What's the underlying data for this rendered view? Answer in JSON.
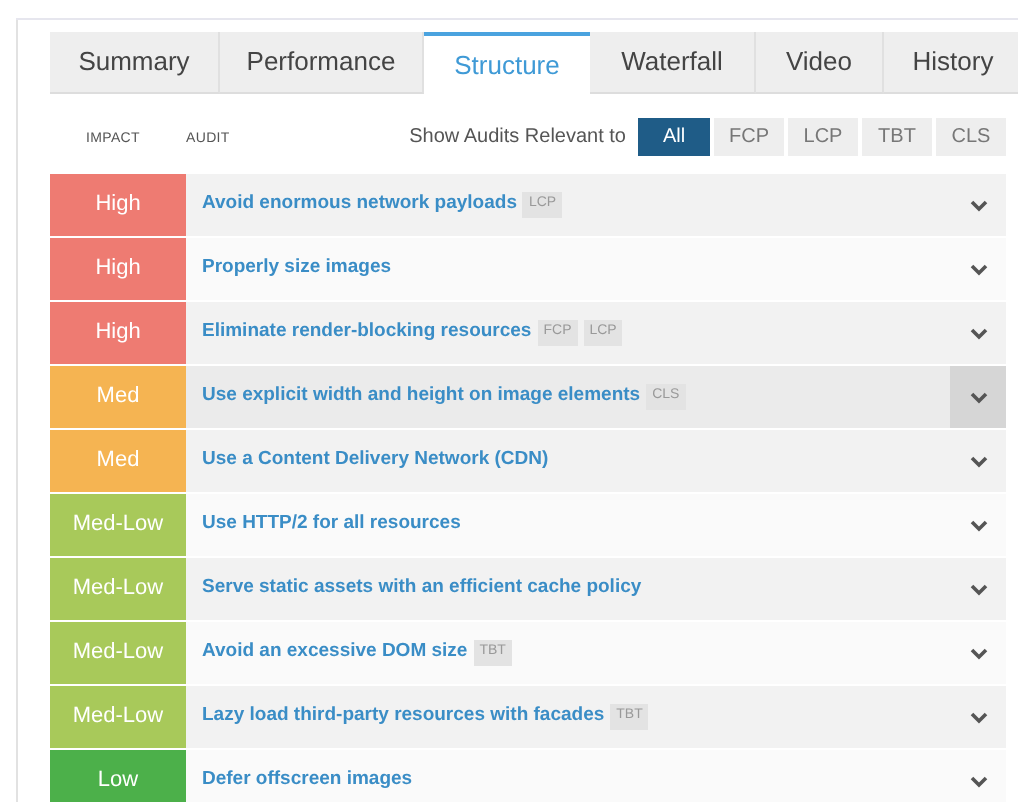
{
  "tabs": [
    {
      "label": "Summary",
      "selected": false
    },
    {
      "label": "Performance",
      "selected": false
    },
    {
      "label": "Structure",
      "selected": true
    },
    {
      "label": "Waterfall",
      "selected": false
    },
    {
      "label": "Video",
      "selected": false
    },
    {
      "label": "History",
      "selected": false
    }
  ],
  "filter": {
    "label": "Show Audits Relevant to",
    "options": [
      {
        "label": "All",
        "selected": true
      },
      {
        "label": "FCP",
        "selected": false
      },
      {
        "label": "LCP",
        "selected": false
      },
      {
        "label": "TBT",
        "selected": false
      },
      {
        "label": "CLS",
        "selected": false
      }
    ]
  },
  "columns": [
    "IMPACT",
    "AUDIT"
  ],
  "audits": [
    {
      "impact": "High",
      "color": "#ee7b72",
      "title": "Avoid enormous network payloads",
      "tags": [
        "LCP"
      ],
      "hovered": false
    },
    {
      "impact": "High",
      "color": "#ee7b72",
      "title": "Properly size images",
      "hovered": false
    },
    {
      "impact": "High",
      "color": "#ee7b72",
      "title": "Eliminate render-blocking resources",
      "tags": [
        "FCP",
        "LCP"
      ],
      "hovered": false
    },
    {
      "impact": "Med",
      "color": "#f5b452",
      "title": "Use explicit width and height on image elements",
      "tags": [
        "CLS"
      ],
      "hovered": true
    },
    {
      "impact": "Med",
      "color": "#f5b452",
      "title": "Use a Content Delivery Network (CDN)",
      "hovered": false
    },
    {
      "impact": "Med-Low",
      "color": "#a8c95a",
      "title": "Use HTTP/2 for all resources",
      "hovered": false
    },
    {
      "impact": "Med-Low",
      "color": "#a8c95a",
      "title": "Serve static assets with an efficient cache policy",
      "hovered": false
    },
    {
      "impact": "Med-Low",
      "color": "#a8c95a",
      "title": "Avoid an excessive DOM size",
      "tags": [
        "TBT"
      ],
      "hovered": false
    },
    {
      "impact": "Med-Low",
      "color": "#a8c95a",
      "title": "Lazy load third-party resources with facades",
      "tags": [
        "TBT"
      ],
      "hovered": false
    },
    {
      "impact": "Low",
      "color": "#4cb04a",
      "title": "Defer offscreen images",
      "hovered": false
    }
  ]
}
